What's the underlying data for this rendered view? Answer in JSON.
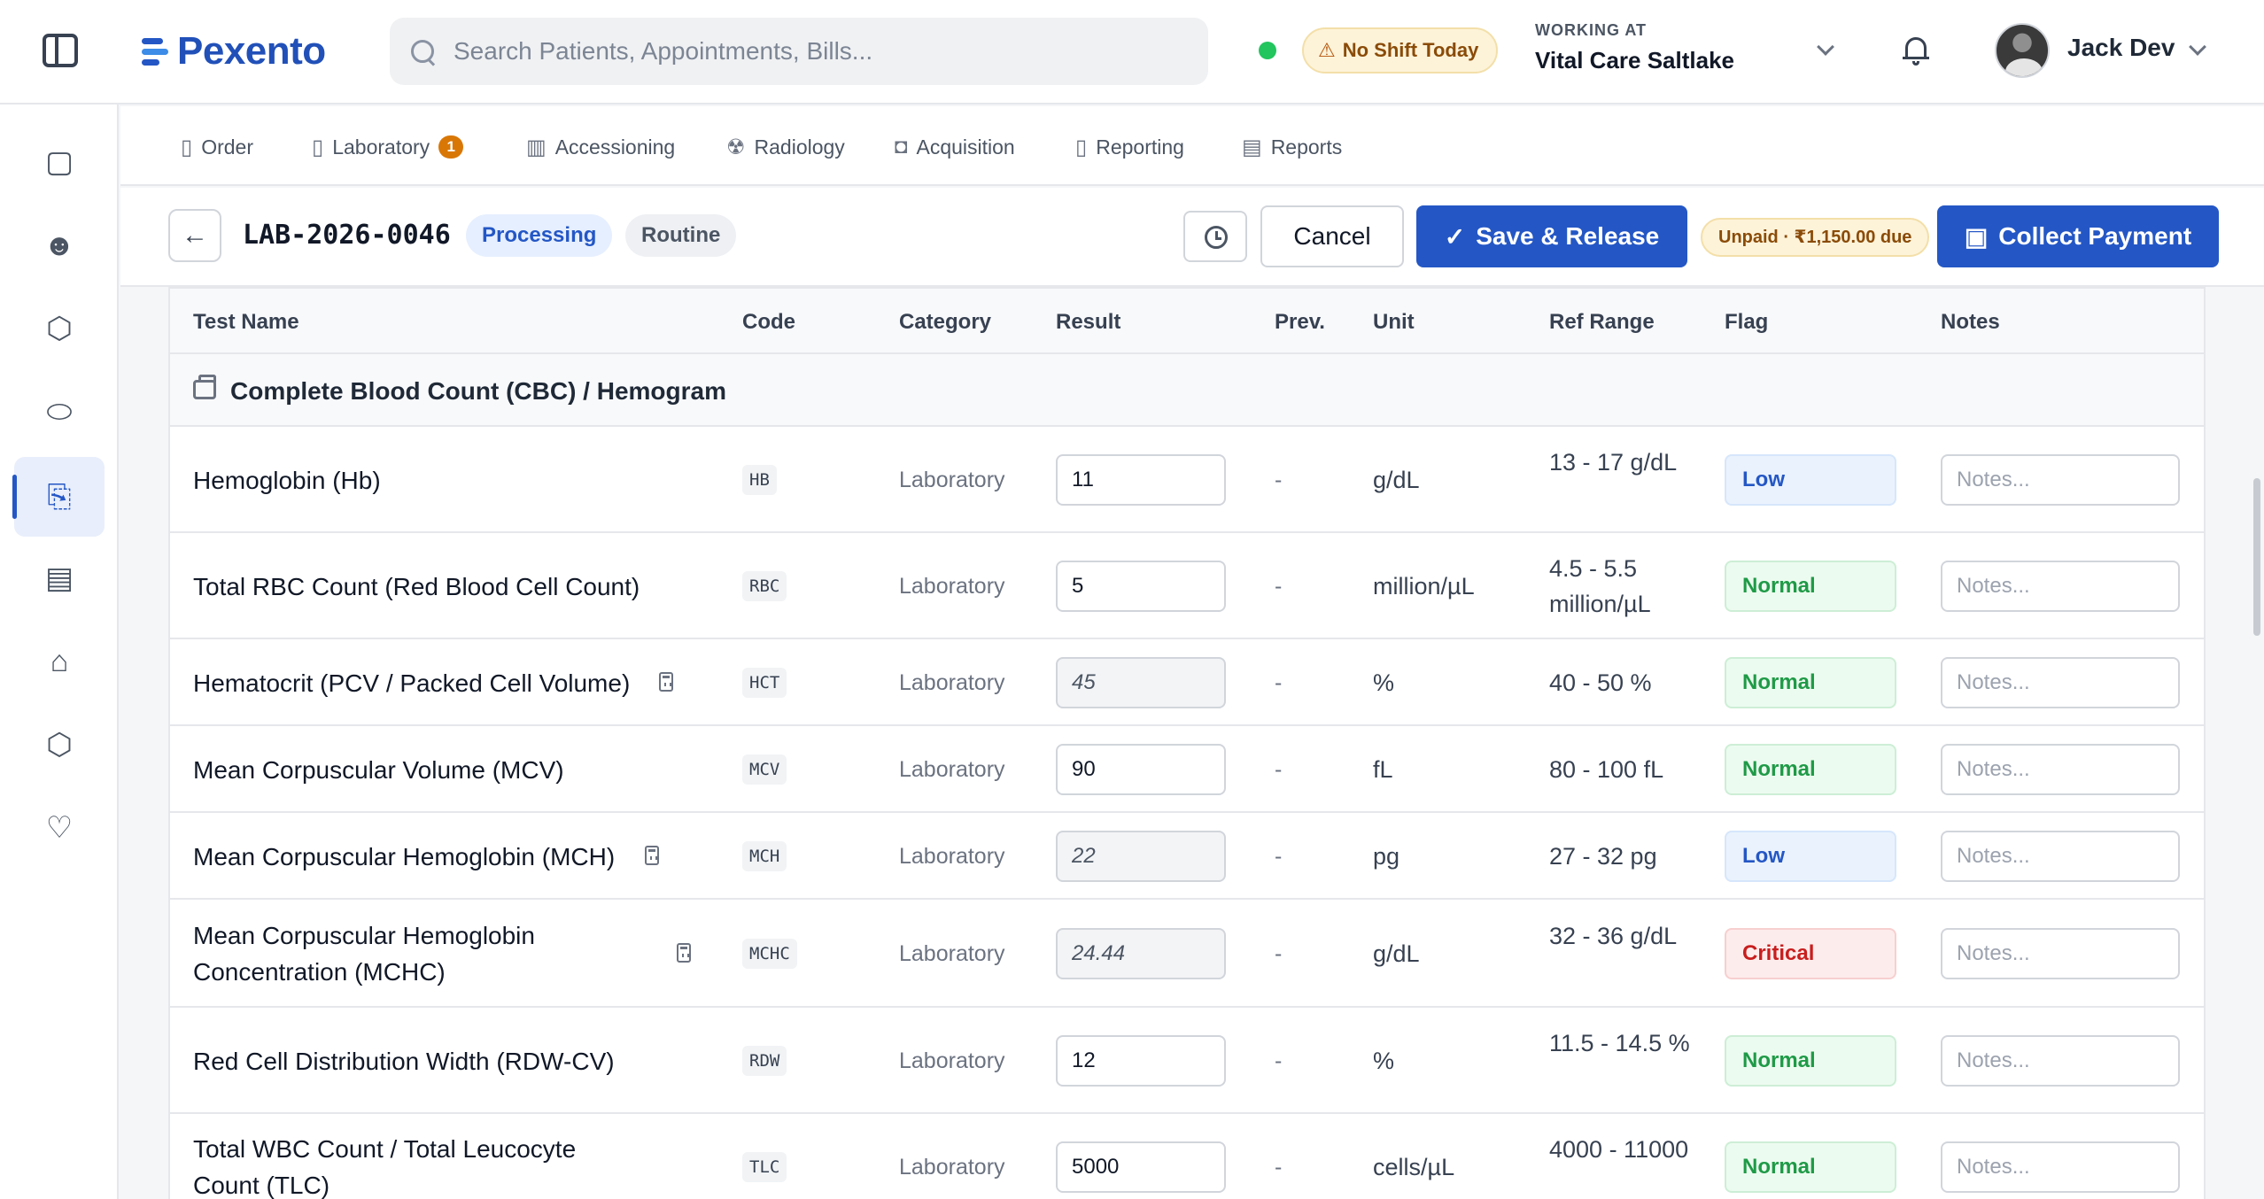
{
  "header": {
    "logo_text": "Pexento",
    "search_placeholder": "Search Patients, Appointments, Bills...",
    "shift_status": "No Shift Today",
    "working_at_label": "WORKING AT",
    "working_at_value": "Vital Care Saltlake",
    "user_name": "Jack Dev",
    "online_color": "#22c55e"
  },
  "rail": {
    "items": [
      {
        "icon": "calendar-icon",
        "glyph": "▢"
      },
      {
        "icon": "patients-icon",
        "glyph": "☻"
      },
      {
        "icon": "cubes-icon",
        "glyph": "⬡"
      },
      {
        "icon": "pill-icon",
        "glyph": "⬭"
      },
      {
        "icon": "lab-report-icon",
        "glyph": "⎘",
        "active": true
      },
      {
        "icon": "billing-icon",
        "glyph": "▤"
      },
      {
        "icon": "tag-icon",
        "glyph": "⌂"
      },
      {
        "icon": "box-icon",
        "glyph": "⬡"
      },
      {
        "icon": "heart-pulse-icon",
        "glyph": "♡"
      }
    ]
  },
  "subnav": {
    "tabs": [
      {
        "label": "Order",
        "icon": "order-icon"
      },
      {
        "label": "Laboratory",
        "icon": "laboratory-icon",
        "badge": "1"
      },
      {
        "label": "Accessioning",
        "icon": "barcode-icon"
      },
      {
        "label": "Radiology",
        "icon": "radiology-icon"
      },
      {
        "label": "Acquisition",
        "icon": "camera-icon"
      },
      {
        "label": "Reporting",
        "icon": "reporting-icon"
      },
      {
        "label": "Reports",
        "icon": "reports-icon"
      }
    ]
  },
  "order": {
    "id": "LAB-2026-0046",
    "status": "Processing",
    "priority": "Routine",
    "cancel_label": "Cancel",
    "save_label": "Save & Release",
    "payment_status": "Unpaid · ₹1,150.00 due",
    "collect_label": "Collect Payment",
    "accent_color": "#2457c5"
  },
  "table": {
    "columns": [
      "Test Name",
      "Code",
      "Category",
      "Result",
      "Prev.",
      "Unit",
      "Ref Range",
      "Flag",
      "Notes"
    ],
    "group_title": "Complete Blood Count (CBC) / Hemogram",
    "notes_placeholder": "Notes...",
    "rows": [
      {
        "name": "Hemoglobin (Hb)",
        "code": "HB",
        "category": "Laboratory",
        "result": "11",
        "calculated": false,
        "prev": "-",
        "unit": "g/dL",
        "range": "13 - 17 g/dL",
        "flag": "Low"
      },
      {
        "name": "Total RBC Count (Red Blood Cell Count)",
        "code": "RBC",
        "category": "Laboratory",
        "result": "5",
        "calculated": false,
        "prev": "-",
        "unit": "million/µL",
        "range": "4.5 - 5.5 million/µL",
        "flag": "Normal"
      },
      {
        "name": "Hematocrit (PCV / Packed Cell Volume)",
        "code": "HCT",
        "category": "Laboratory",
        "result": "45",
        "calculated": true,
        "prev": "-",
        "unit": "%",
        "range": "40 - 50 %",
        "flag": "Normal"
      },
      {
        "name": "Mean Corpuscular Volume (MCV)",
        "code": "MCV",
        "category": "Laboratory",
        "result": "90",
        "calculated": false,
        "prev": "-",
        "unit": "fL",
        "range": "80 - 100 fL",
        "flag": "Normal"
      },
      {
        "name": "Mean Corpuscular Hemoglobin (MCH)",
        "code": "MCH",
        "category": "Laboratory",
        "result": "22",
        "calculated": true,
        "prev": "-",
        "unit": "pg",
        "range": "27 - 32 pg",
        "flag": "Low"
      },
      {
        "name": "Mean Corpuscular Hemoglobin Concentration (MCHC)",
        "code": "MCHC",
        "category": "Laboratory",
        "result": "24.44",
        "calculated": true,
        "prev": "-",
        "unit": "g/dL",
        "range": "32 - 36 g/dL",
        "flag": "Critical"
      },
      {
        "name": "Red Cell Distribution Width (RDW-CV)",
        "code": "RDW",
        "category": "Laboratory",
        "result": "12",
        "calculated": false,
        "prev": "-",
        "unit": "%",
        "range": "11.5 - 14.5 %",
        "flag": "Normal"
      },
      {
        "name": "Total WBC Count / Total Leucocyte Count (TLC)",
        "code": "TLC",
        "category": "Laboratory",
        "result": "5000",
        "calculated": false,
        "prev": "-",
        "unit": "cells/µL",
        "range": "4000 - 11000",
        "flag": "Normal"
      }
    ]
  }
}
